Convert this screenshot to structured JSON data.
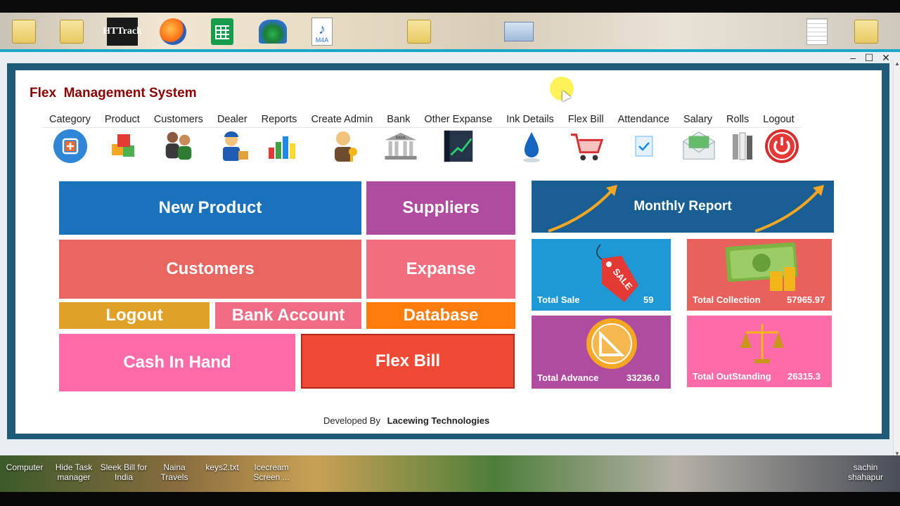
{
  "desktop_top_icons": [
    "folder-icon",
    "folder-icon",
    "httrack-icon",
    "firefox-icon",
    "sheets-icon",
    "idm-icon",
    "m4a-file-icon",
    "folder-icon",
    "screenshot-icon",
    "document-icon",
    "folder-icon"
  ],
  "desktop_top": {
    "httrack_label": "HTTrack",
    "m4a_label": "M4A"
  },
  "window": {
    "minimize": "–",
    "maximize": "☐",
    "close": "✕"
  },
  "app": {
    "title": "Flex  Management System",
    "menu": [
      "Category",
      "Product",
      "Customers",
      "Dealer",
      "Reports",
      "Create Admin",
      "Bank",
      "Other Expanse",
      "Ink Details",
      "Flex Bill",
      "Attendance",
      "Salary",
      "Rolls",
      "Logout"
    ],
    "toolbar_icons": [
      "category-icon",
      "product-icon",
      "customers-icon",
      "dealer-icon",
      "reports-icon",
      "create-admin-icon",
      "bank-icon",
      "other-expanse-icon",
      "ink-details-icon",
      "flex-bill-icon",
      "attendance-icon",
      "salary-icon",
      "rolls-icon",
      "logout-icon"
    ],
    "bank_icon_label": "BANK"
  },
  "tiles": {
    "new_product": "New Product",
    "suppliers": "Suppliers",
    "customers": "Customers",
    "expanse": "Expanse",
    "logout": "Logout",
    "bank_account": "Bank Account",
    "database": "Database",
    "cash_in_hand": "Cash In Hand",
    "flex_bill": "Flex Bill",
    "monthly_report": "Monthly Report"
  },
  "stats": {
    "total_sale": {
      "label": "Total Sale",
      "value": "59",
      "tag": "SALE"
    },
    "total_collection": {
      "label": "Total Collection",
      "value": "57965.97"
    },
    "total_advance": {
      "label": "Total  Advance",
      "value": "33236.0"
    },
    "total_outstanding": {
      "label": "Total OutStanding",
      "value": "26315.3"
    }
  },
  "footer": {
    "prefix": "Developed By",
    "company": "Lacewing Technologies"
  },
  "desktop_bottom": {
    "items": [
      "Computer",
      "Hide Task manager",
      "Sleek Bill for India",
      "Naina Travels",
      "keys2.txt",
      "Icecream Screen ..."
    ],
    "user": "sachin shahapur"
  },
  "colors": {
    "title": "#8b0000",
    "new_product": "#1a72bd",
    "suppliers": "#b04ca0",
    "customers": "#e86560",
    "expanse": "#f26d7d",
    "logout": "#e0a128",
    "bank_account": "#f06b84",
    "database": "#ff7c0a",
    "cash_in_hand": "#ff6aa8",
    "flex_bill": "#f04a36",
    "monthly_report": "#1a5f94",
    "total_sale": "#1f98d6",
    "total_collection": "#e8615d",
    "total_advance": "#b04ca0",
    "total_outstanding": "#ff6aa8"
  }
}
